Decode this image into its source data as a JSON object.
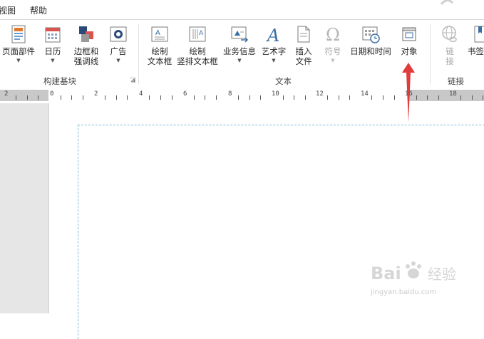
{
  "menu": {
    "view_tab": "视图",
    "help_tab": "帮助"
  },
  "ribbon": {
    "groups": {
      "building_blocks": "构建基块",
      "text": "文本",
      "links": "链接"
    },
    "buttons": {
      "page_parts": "页面部件",
      "calendar": "日历",
      "borders_line1": "边框和",
      "borders_line2": "强调线",
      "ads": "广告",
      "draw_textbox_line1": "绘制",
      "draw_textbox_line2": "文本框",
      "draw_vtextbox_line1": "绘制",
      "draw_vtextbox_line2": "竖排文本框",
      "business_info": "业务信息",
      "wordart": "艺术字",
      "insert_file_line1": "插入",
      "insert_file_line2": "文件",
      "symbol": "符号",
      "date_time": "日期和时间",
      "object": "对象",
      "link_line1": "链",
      "link_line2": "接",
      "bookmark": "书签"
    }
  },
  "ruler": {
    "labels": [
      "2",
      "0",
      "2",
      "4",
      "6",
      "8",
      "10",
      "12",
      "14",
      "16",
      "18"
    ]
  },
  "annotation": {
    "arrow_color": "#e03c3c"
  },
  "watermark": {
    "brand": "Bai 经验",
    "url": "jingyan.baidu.com"
  }
}
